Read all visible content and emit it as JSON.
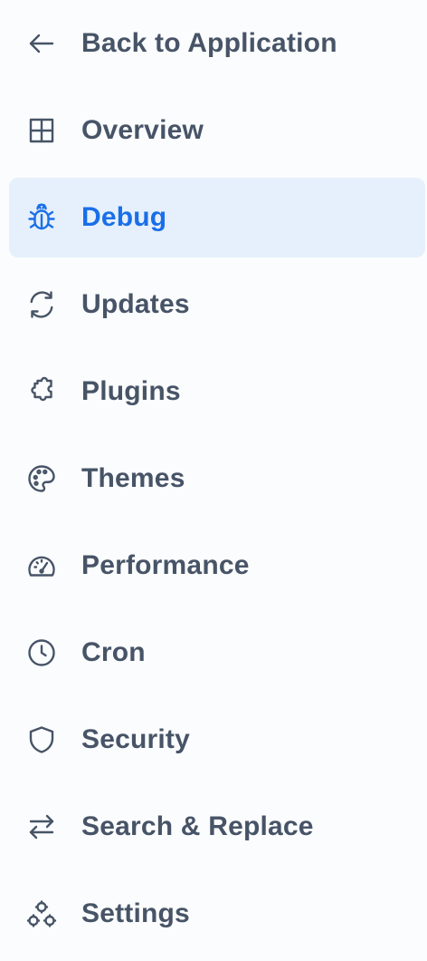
{
  "nav": {
    "back": {
      "label": "Back to Application",
      "icon": "arrow-left-icon"
    },
    "items": [
      {
        "label": "Overview",
        "icon": "grid-icon"
      },
      {
        "label": "Debug",
        "icon": "bug-icon",
        "active": true
      },
      {
        "label": "Updates",
        "icon": "refresh-icon"
      },
      {
        "label": "Plugins",
        "icon": "puzzle-icon"
      },
      {
        "label": "Themes",
        "icon": "palette-icon"
      },
      {
        "label": "Performance",
        "icon": "gauge-icon"
      },
      {
        "label": "Cron",
        "icon": "clock-icon"
      },
      {
        "label": "Security",
        "icon": "shield-icon"
      },
      {
        "label": "Search & Replace",
        "icon": "swap-icon"
      },
      {
        "label": "Settings",
        "icon": "settings-nodes-icon"
      }
    ]
  },
  "colors": {
    "text": "#475467",
    "active_text": "#1a6fe8",
    "active_bg": "#e6f0fc",
    "background": "#fbfcfd"
  }
}
